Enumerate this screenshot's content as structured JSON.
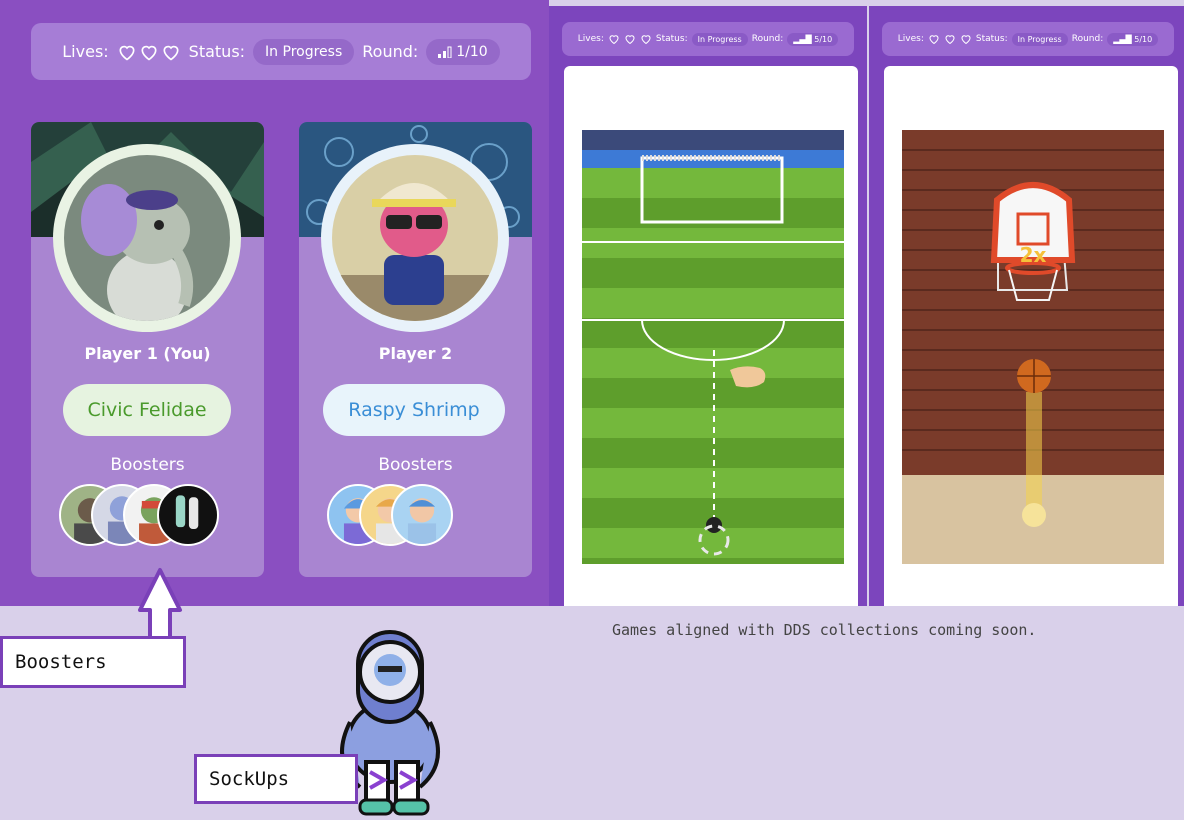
{
  "status": {
    "lives_label": "Lives:",
    "status_label": "Status:",
    "status_value": "In Progress",
    "round_label": "Round:",
    "round_value": "1/10"
  },
  "players": [
    {
      "name": "Player 1 (You)",
      "nft": "Civic Felidae",
      "boosters_label": "Boosters"
    },
    {
      "name": "Player 2",
      "nft": "Raspy Shrimp",
      "boosters_label": "Boosters"
    }
  ],
  "phones": [
    {
      "lives_label": "Lives:",
      "status_label": "Status:",
      "status_value": "In Progress",
      "round_label": "Round:",
      "round_value": "5/10",
      "game": "soccer"
    },
    {
      "lives_label": "Lives:",
      "status_label": "Status:",
      "status_value": "In Progress",
      "round_label": "Round:",
      "round_value": "5/10",
      "game": "basketball",
      "multiplier": "2x"
    }
  ],
  "caption": "Games aligned with DDS collections coming soon.",
  "callouts": {
    "boosters": "Boosters",
    "sockups": "SockUps"
  },
  "colors": {
    "panel": "#8a4fc1",
    "card": "#a985d1",
    "background": "#d9d0ea",
    "nft_pill_1": "#e6f3e0",
    "nft_pill_2": "#e8f4fb"
  }
}
